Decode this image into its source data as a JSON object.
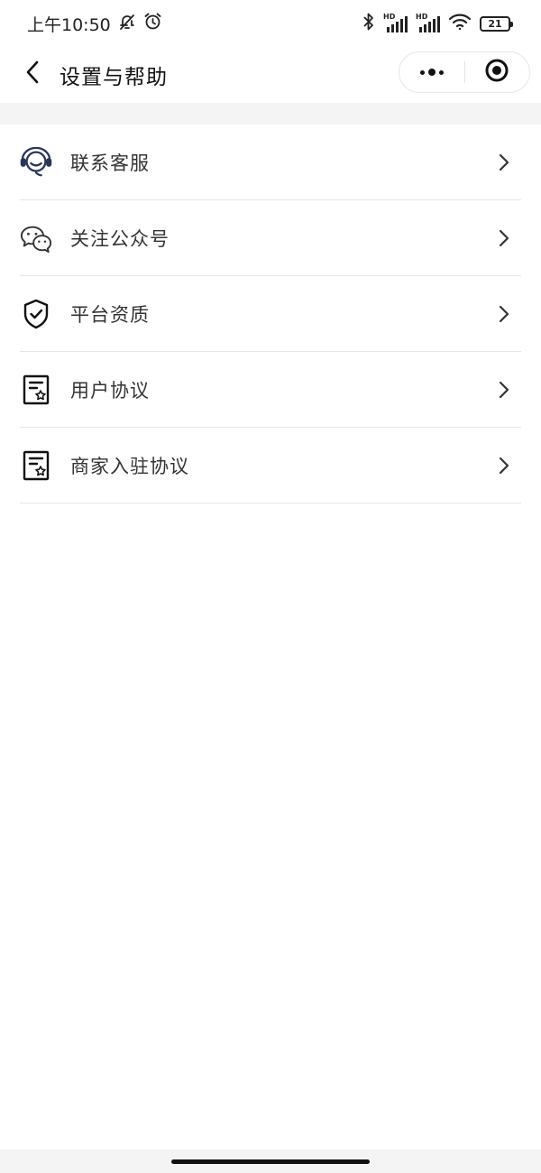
{
  "status_bar": {
    "time": "上午10:50",
    "battery": "21",
    "icons": [
      "bell-off-icon",
      "alarm-icon",
      "bluetooth-icon",
      "hd-signal-icon",
      "hd-signal-icon",
      "wifi-icon",
      "battery-icon"
    ],
    "hd_label": "HD"
  },
  "nav": {
    "title": "设置与帮助",
    "back_icon": "chevron-left-icon",
    "more_icon": "more-icon",
    "close_icon": "target-icon"
  },
  "menu": {
    "items": [
      {
        "label": "联系客服",
        "icon": "headset-icon"
      },
      {
        "label": "关注公众号",
        "icon": "wechat-icon"
      },
      {
        "label": "平台资质",
        "icon": "shield-check-icon"
      },
      {
        "label": "用户协议",
        "icon": "document-star-icon"
      },
      {
        "label": "商家入驻协议",
        "icon": "document-star-icon"
      }
    ]
  },
  "colors": {
    "background": "#ffffff",
    "band": "#f4f4f4",
    "divider": "#e6e6e6",
    "text": "#333333",
    "icon_navy": "#2a3558"
  }
}
